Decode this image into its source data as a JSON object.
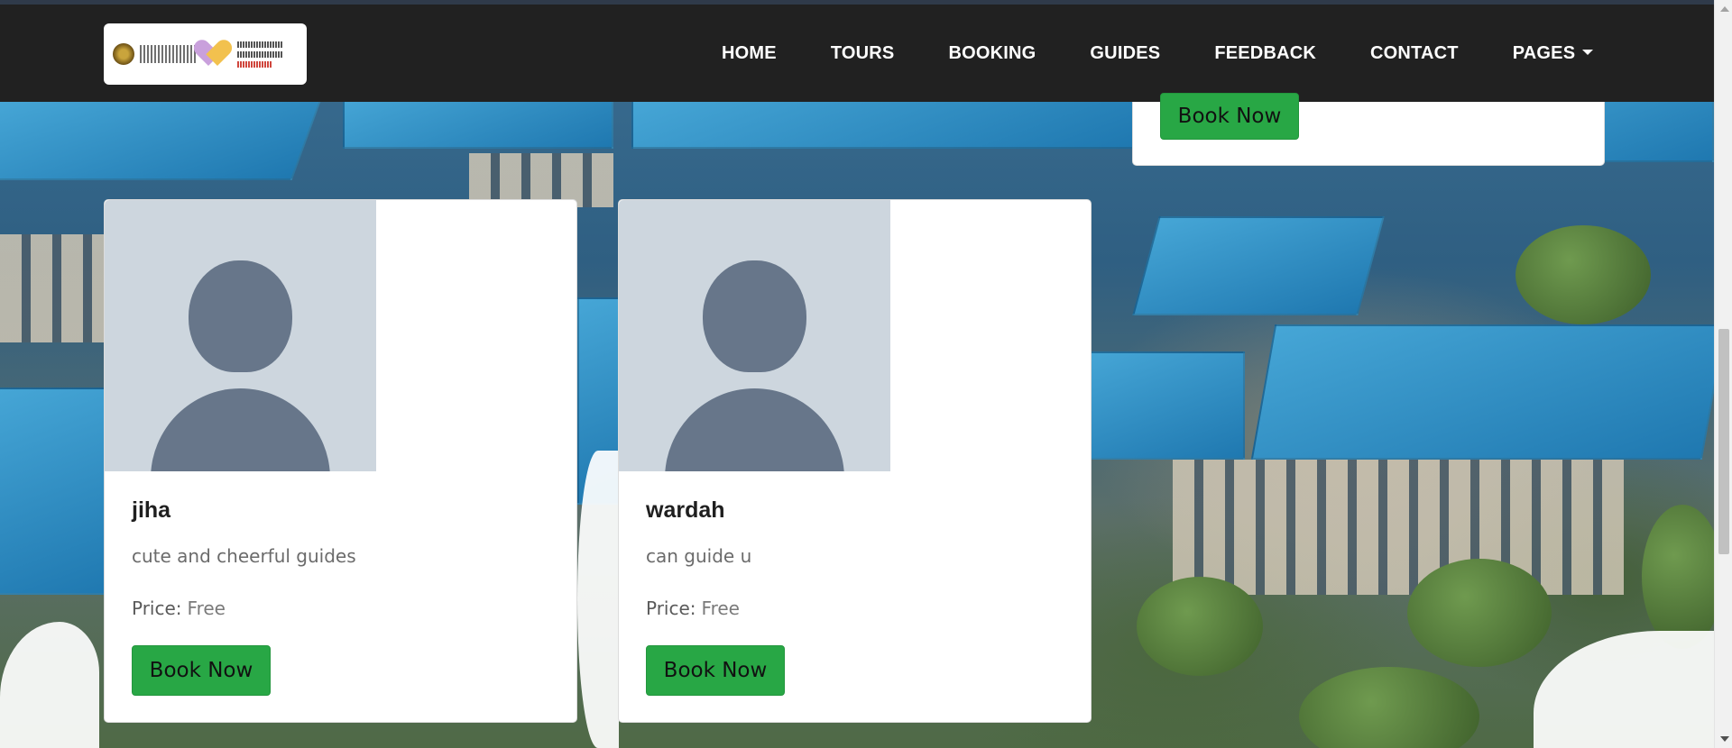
{
  "nav": {
    "logo_alt": "logo",
    "items": [
      {
        "label": "HOME"
      },
      {
        "label": "TOURS"
      },
      {
        "label": "BOOKING"
      },
      {
        "label": "GUIDES"
      },
      {
        "label": "FEEDBACK"
      },
      {
        "label": "CONTACT"
      },
      {
        "label": "PAGES",
        "dropdown": true
      }
    ]
  },
  "partial_card": {
    "button_label": "Book Now"
  },
  "guides": [
    {
      "name": "jiha",
      "description": "cute and cheerful guides",
      "price_label": "Price:",
      "price_value": "Free",
      "button_label": "Book Now"
    },
    {
      "name": "wardah",
      "description": "can guide u",
      "price_label": "Price:",
      "price_value": "Free",
      "button_label": "Book Now"
    }
  ],
  "colors": {
    "navbar_bg": "#212121",
    "book_button": "#28a745",
    "avatar_bg": "#cdd6de",
    "avatar_fg": "#67768a"
  },
  "icons": [
    "chevron-down-icon",
    "avatar-placeholder-icon"
  ]
}
